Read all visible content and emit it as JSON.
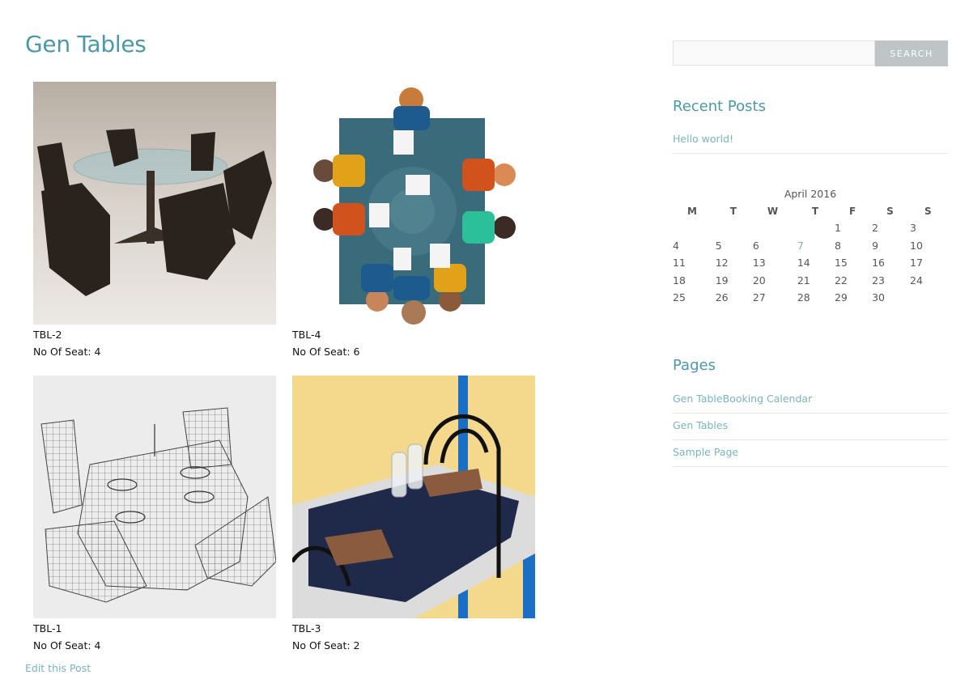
{
  "page": {
    "title": "Gen Tables",
    "edit_link": "Edit this Post"
  },
  "products": [
    {
      "name": "TBL-2",
      "seats": "No Of Seat: 4"
    },
    {
      "name": "TBL-4",
      "seats": "No Of Seat: 6"
    },
    {
      "name": "TBL-1",
      "seats": "No Of Seat: 4"
    },
    {
      "name": "TBL-3",
      "seats": "No Of Seat: 2"
    }
  ],
  "sidebar": {
    "search": {
      "placeholder": "",
      "button": "SEARCH"
    },
    "recent_posts": {
      "title": "Recent Posts",
      "items": [
        "Hello world!"
      ]
    },
    "calendar": {
      "caption": "April 2016",
      "weekdays": [
        "M",
        "T",
        "W",
        "T",
        "F",
        "S",
        "S"
      ],
      "weeks": [
        [
          "",
          "",
          "",
          "",
          "1",
          "2",
          "3"
        ],
        [
          "4",
          "5",
          "6",
          "7",
          "8",
          "9",
          "10"
        ],
        [
          "11",
          "12",
          "13",
          "14",
          "15",
          "16",
          "17"
        ],
        [
          "18",
          "19",
          "20",
          "21",
          "22",
          "23",
          "24"
        ],
        [
          "25",
          "26",
          "27",
          "28",
          "29",
          "30",
          ""
        ]
      ],
      "linked_day": "7"
    },
    "pages": {
      "title": "Pages",
      "items": [
        "Gen TableBooking Calendar",
        "Gen Tables",
        "Sample Page"
      ]
    }
  },
  "colors": {
    "accent": "#4c98a8",
    "link": "#7ab3c0",
    "button": "#bfc4c7"
  }
}
